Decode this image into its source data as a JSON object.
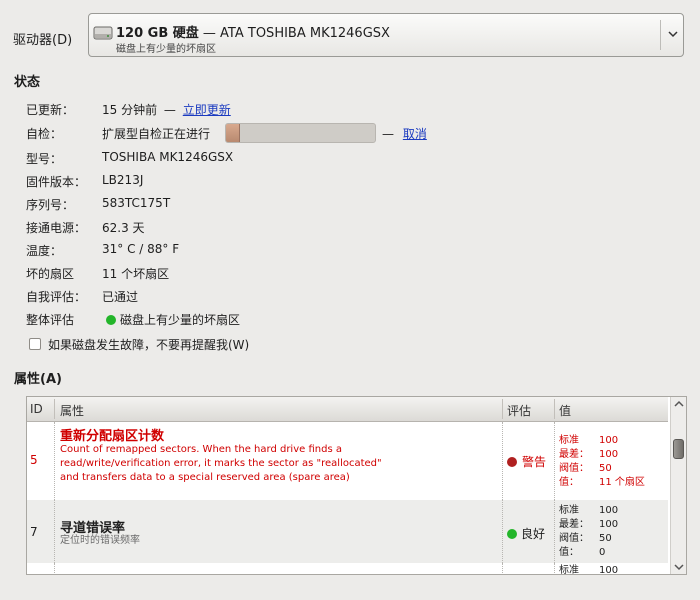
{
  "drive": {
    "label": "驱动器(D)",
    "title_size": "120 GB 硬盘",
    "title_dash": " — ",
    "title_model": "ATA TOSHIBA MK1246GSX",
    "subtitle": "磁盘上有少量的坏扇区",
    "icon": "hard-disk-icon"
  },
  "status": {
    "heading": "状态",
    "updated_label": "已更新：",
    "updated_value": "15 分钟前",
    "updated_dash": "—",
    "update_now": "立即更新",
    "selftest_label": "自检：",
    "selftest_value": "扩展型自检正在进行",
    "selftest_progress": 0.09,
    "selftest_dash": "—",
    "cancel": "取消",
    "model_label": "型号：",
    "model_value": "TOSHIBA MK1246GSX",
    "firmware_label": "固件版本：",
    "firmware_value": "LB213J",
    "serial_label": "序列号：",
    "serial_value": "583TC175T",
    "power_label": "接通电源：",
    "power_value": "62.3 天",
    "temp_label": "温度：",
    "temp_value": "31° C / 88° F",
    "bad_label": "坏的扇区",
    "bad_value": "11 个坏扇区",
    "self_assess_label": "自我评估：",
    "self_assess_value": "已通过",
    "overall_label": "整体评估",
    "overall_value": "磁盘上有少量的坏扇区",
    "overall_color": "#23b52a"
  },
  "checkbox": {
    "label": "如果磁盘发生故障，不要再提醒我(W)",
    "checked": false
  },
  "attributes": {
    "heading": "属性(A)",
    "columns": [
      "ID",
      "属性",
      "评估",
      "值"
    ],
    "rows": [
      {
        "id": "5",
        "name": "重新分配扇区计数",
        "description": "Count of remapped sectors. When the hard drive finds a read/write/verification error, it marks the sector as \"reallocated\" and transfers data to a special reserved area (spare area)",
        "assessment": "警告",
        "assessment_color": "#b02020",
        "normalized_label": "标准",
        "normalized": "100",
        "worst_label": "最差：",
        "worst": "100",
        "threshold_label": "阀值：",
        "threshold": "50",
        "value_label": "值：",
        "value": "11 个扇区",
        "warning": true
      },
      {
        "id": "7",
        "name": "寻道错误率",
        "description": "定位时的错误频率",
        "assessment": "良好",
        "assessment_color": "#23b52a",
        "normalized_label": "标准",
        "normalized": "100",
        "worst_label": "最差：",
        "worst": "100",
        "threshold_label": "阀值：",
        "threshold": "50",
        "value_label": "值：",
        "value": "0",
        "warning": false
      },
      {
        "normalized_label": "标准",
        "normalized": "100"
      }
    ]
  }
}
